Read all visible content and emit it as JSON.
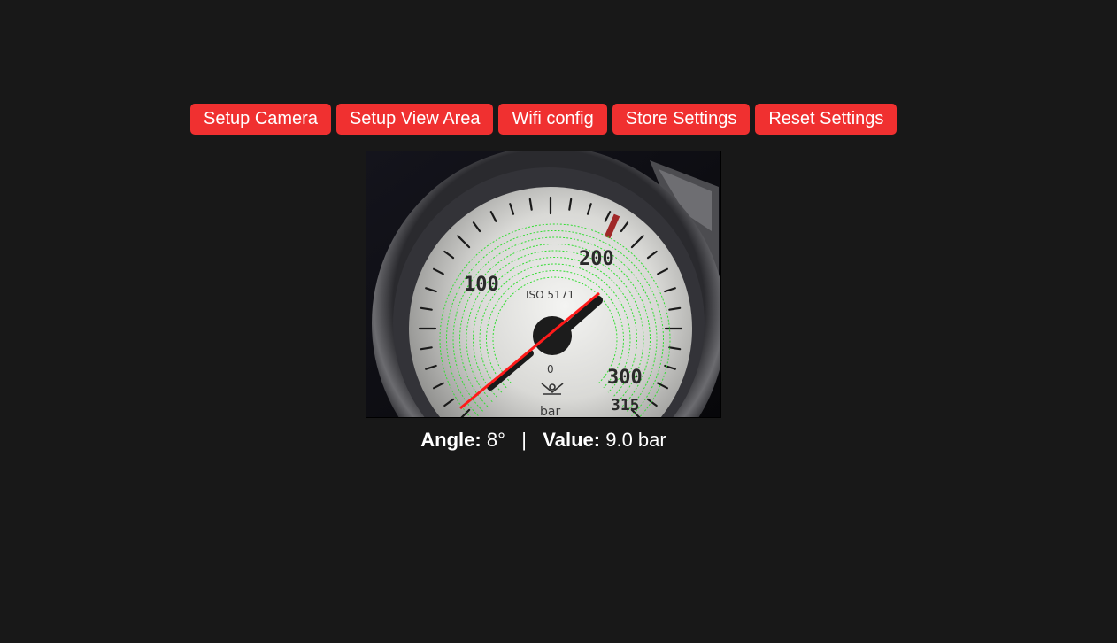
{
  "toolbar": {
    "buttons": [
      {
        "label": "Setup Camera"
      },
      {
        "label": "Setup View Area"
      },
      {
        "label": "Wifi config"
      },
      {
        "label": "Store Settings"
      },
      {
        "label": "Reset Settings"
      }
    ],
    "button_color": "#f03030"
  },
  "gauge": {
    "scale_labels": [
      "100",
      "200",
      "300",
      "315"
    ],
    "standard_text": "ISO 5171",
    "zero_label": "0",
    "unit_text": "bar",
    "needle_color": "#ff1a1a",
    "detection_ring_color": "#33dd33"
  },
  "readout": {
    "angle_label": "Angle:",
    "angle_value": "8°",
    "separator": "|",
    "value_label": "Value:",
    "value_value": "9.0 bar"
  }
}
